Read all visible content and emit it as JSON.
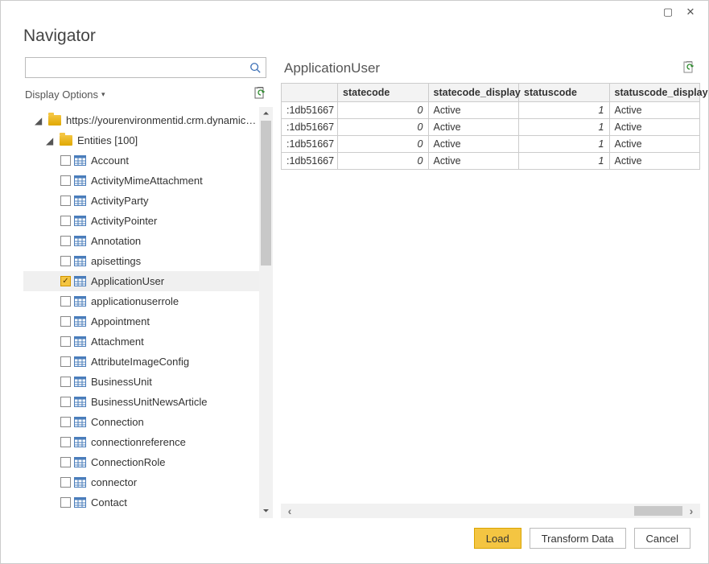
{
  "window": {
    "title": "Navigator"
  },
  "search": {
    "placeholder": ""
  },
  "display_options": {
    "label": "Display Options"
  },
  "tree": {
    "root": {
      "label": "https://yourenvironmentid.crm.dynamics...",
      "expanded": true
    },
    "entities_node": {
      "label": "Entities [100]",
      "expanded": true
    },
    "items": [
      {
        "label": "Account",
        "checked": false
      },
      {
        "label": "ActivityMimeAttachment",
        "checked": false
      },
      {
        "label": "ActivityParty",
        "checked": false
      },
      {
        "label": "ActivityPointer",
        "checked": false
      },
      {
        "label": "Annotation",
        "checked": false
      },
      {
        "label": "apisettings",
        "checked": false
      },
      {
        "label": "ApplicationUser",
        "checked": true
      },
      {
        "label": "applicationuserrole",
        "checked": false
      },
      {
        "label": "Appointment",
        "checked": false
      },
      {
        "label": "Attachment",
        "checked": false
      },
      {
        "label": "AttributeImageConfig",
        "checked": false
      },
      {
        "label": "BusinessUnit",
        "checked": false
      },
      {
        "label": "BusinessUnitNewsArticle",
        "checked": false
      },
      {
        "label": "Connection",
        "checked": false
      },
      {
        "label": "connectionreference",
        "checked": false
      },
      {
        "label": "ConnectionRole",
        "checked": false
      },
      {
        "label": "connector",
        "checked": false
      },
      {
        "label": "Contact",
        "checked": false
      }
    ]
  },
  "preview": {
    "title": "ApplicationUser",
    "columns": [
      "",
      "statecode",
      "statecode_display",
      "statuscode",
      "statuscode_display"
    ],
    "rows": [
      {
        "id": ":1db51667",
        "statecode": "0",
        "statecode_display": "Active",
        "statuscode": "1",
        "statuscode_display": "Active"
      },
      {
        "id": ":1db51667",
        "statecode": "0",
        "statecode_display": "Active",
        "statuscode": "1",
        "statuscode_display": "Active"
      },
      {
        "id": ":1db51667",
        "statecode": "0",
        "statecode_display": "Active",
        "statuscode": "1",
        "statuscode_display": "Active"
      },
      {
        "id": ":1db51667",
        "statecode": "0",
        "statecode_display": "Active",
        "statuscode": "1",
        "statuscode_display": "Active"
      }
    ]
  },
  "footer": {
    "load": "Load",
    "transform": "Transform Data",
    "cancel": "Cancel"
  }
}
